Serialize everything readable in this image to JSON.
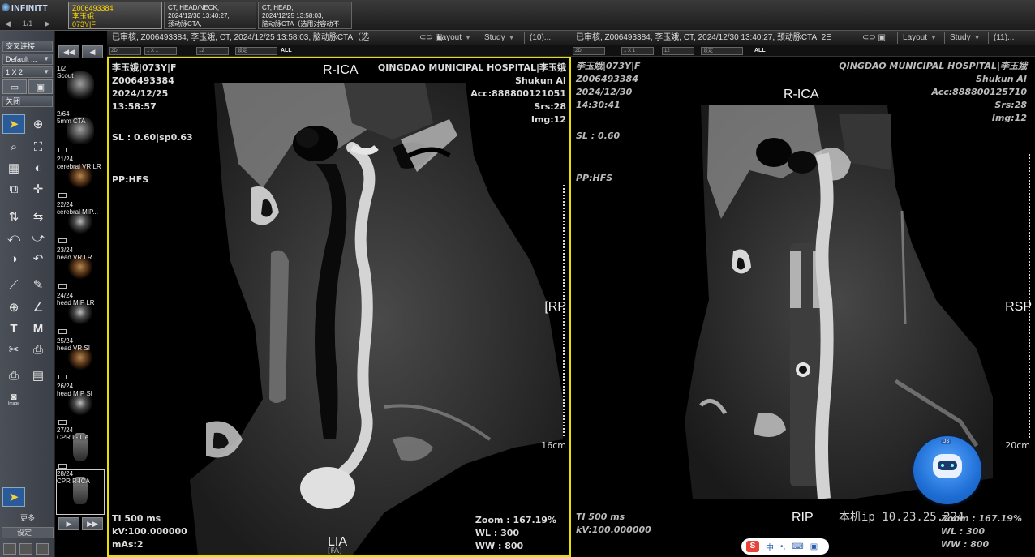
{
  "app": {
    "logo_text": "INFINITT",
    "pager": {
      "prev": "◀",
      "value": "1/1",
      "next": "▶"
    }
  },
  "study_tabs": [
    {
      "line1": "Z006493384",
      "line2": "李玉娥",
      "line3": "073Y|F"
    },
    {
      "line1": "CT, HEAD/NECK,",
      "line2": "2024/12/30 13:40:27,",
      "line3": "颈动脉CTA,"
    },
    {
      "line1": "CT, HEAD,",
      "line2": "2024/12/25 13:58:03,",
      "line3": "脑动脉CTA（选用对容动不良..."
    }
  ],
  "left_toolbar": {
    "link_label": "交叉连接",
    "preset_value": "Default ...",
    "layout_value": "1 X 2",
    "close_label": "关闭",
    "more_label": "更多",
    "settings_label": "设定",
    "snapshot_label": "Image"
  },
  "thumb_nav": {
    "prev": "◀◀",
    "back": "◀",
    "next": "▶",
    "next_all": "▶▶"
  },
  "thumbnails": [
    {
      "label": "1/2\nScout",
      "kind": "scout"
    },
    {
      "label": "2/64\n5mm CTA",
      "kind": "ct"
    },
    {
      "label": "21/24\ncerebral VR LR",
      "kind": "vr"
    },
    {
      "label": "22/24\ncerebral MIP...",
      "kind": "mip"
    },
    {
      "label": "23/24\nhead VR LR",
      "kind": "vr"
    },
    {
      "label": "24/24\nhead MIP LR",
      "kind": "mip"
    },
    {
      "label": "25/24\nhead VR SI",
      "kind": "vr"
    },
    {
      "label": "26/24\nhead MIP SI",
      "kind": "mip"
    },
    {
      "label": "27/24\nCPR L-ICA",
      "kind": "cpr"
    },
    {
      "label": "28/24\nCPR R-ICA",
      "kind": "cpr"
    }
  ],
  "viewport1": {
    "header_title": "已审核, Z006493384, 李玉娥, CT, 2024/12/25 13:58:03, 脑动脉CTA（选",
    "layout_label": "Layout",
    "study_label": "Study",
    "count_label": "(10)...",
    "subbar": {
      "a": "2D",
      "b": "1 X 1",
      "c": "12",
      "d": "设定",
      "all": "ALL"
    },
    "top_left": "李玉娥|073Y|F\nZ006493384\n2024/12/25\n13:58:57",
    "top_left2": "SL : 0.60|sp0.63",
    "top_left3": "PP:HFS",
    "top_right": "QINGDAO MUNICIPAL HOSPITAL|李玉娥\nShukun AI\nAcc:888800121051\nSrs:28\nImg:12",
    "orient_top": "R-ICA",
    "orient_right": "[RP",
    "orient_bottom": "LIA",
    "orient_bottom_sub": "[FA]",
    "scale": "16cm",
    "bottom_left": "TI 500 ms\nkV:100.000000\nmAs:2",
    "bottom_right": "Zoom : 167.19%\nWL : 300\nWW : 800"
  },
  "viewport2": {
    "header_title": "已审核, Z006493384, 李玉娥, CT, 2024/12/30 13:40:27, 颈动脉CTA, 2E",
    "layout_label": "Layout",
    "study_label": "Study",
    "count_label": "(11)...",
    "subbar": {
      "a": "2D",
      "b": "1 X 1",
      "c": "12",
      "d": "设定",
      "all": "ALL"
    },
    "top_left": "李玉娥|073Y|F\nZ006493384\n2024/12/30\n14:30:41",
    "top_left2": "SL : 0.60",
    "top_left3": "PP:HFS",
    "top_right": "QINGDAO MUNICIPAL HOSPITAL|李玉娥\nShukun AI\nAcc:888800125710\nSrs:28\nImg:12",
    "orient_top": "R-ICA",
    "orient_right": "RSP",
    "orient_bottom": "RIP",
    "scale": "20cm",
    "bottom_left": "TI 500 ms\nkV:100.000000",
    "bottom_right": "Zoom : 167.19%\nWL : 300\nWW : 800",
    "local_ip": "本机ip 10.23.25.224"
  },
  "assistant_badge": "DS",
  "ime_bar": {
    "brand": "S",
    "mode": "中"
  }
}
